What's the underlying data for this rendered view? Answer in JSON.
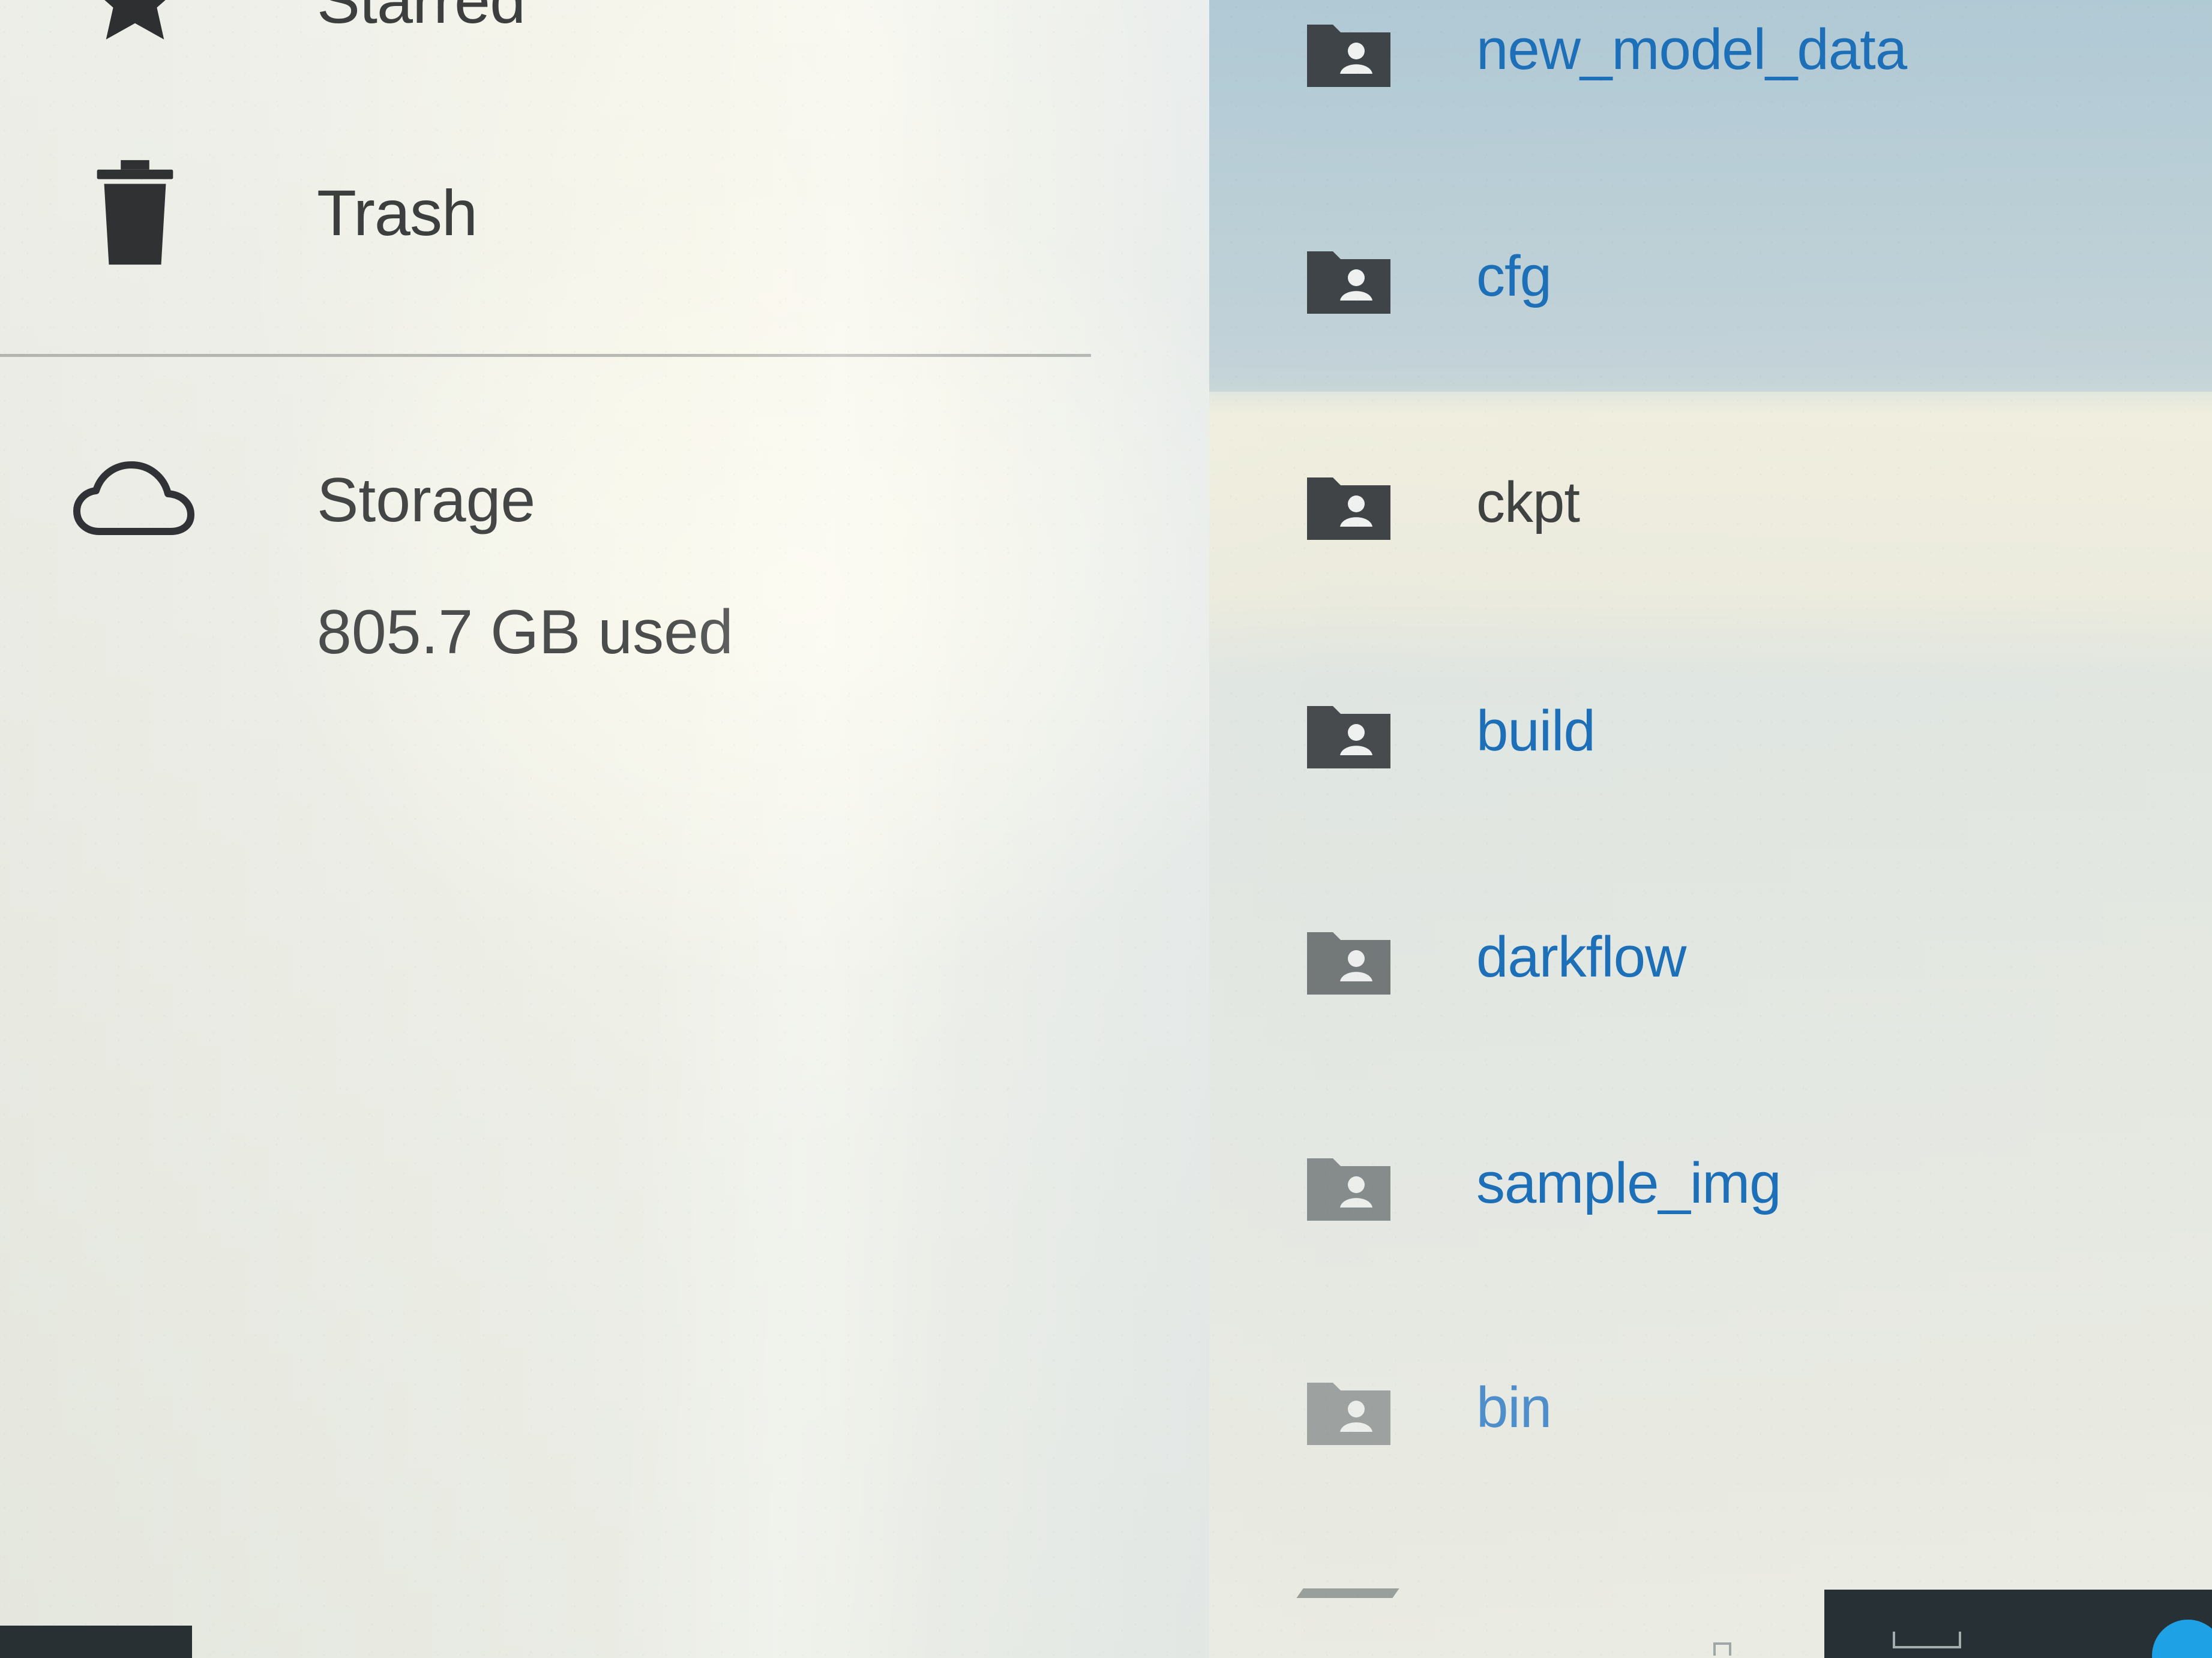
{
  "sidebar": {
    "items": [
      {
        "label": "Starred",
        "icon": "star-icon"
      },
      {
        "label": "Trash",
        "icon": "trash-icon"
      }
    ],
    "storage": {
      "label": "Storage",
      "used": "805.7 GB used",
      "icon": "cloud-icon"
    }
  },
  "files": [
    {
      "name": "new_model_data",
      "icon": "shared-folder-icon"
    },
    {
      "name": "cfg",
      "icon": "shared-folder-icon"
    },
    {
      "name": "ckpt",
      "icon": "shared-folder-icon"
    },
    {
      "name": "build",
      "icon": "shared-folder-icon"
    },
    {
      "name": "darkflow",
      "icon": "shared-folder-icon"
    },
    {
      "name": "sample_img",
      "icon": "shared-folder-icon"
    },
    {
      "name": "bin",
      "icon": "shared-folder-icon"
    }
  ],
  "colors": {
    "folder": "#3f4448",
    "link": "#1d6fb8",
    "selected": "#b6ccd5",
    "dark_taskbar": "#273135",
    "accent": "#1fa1e6"
  }
}
